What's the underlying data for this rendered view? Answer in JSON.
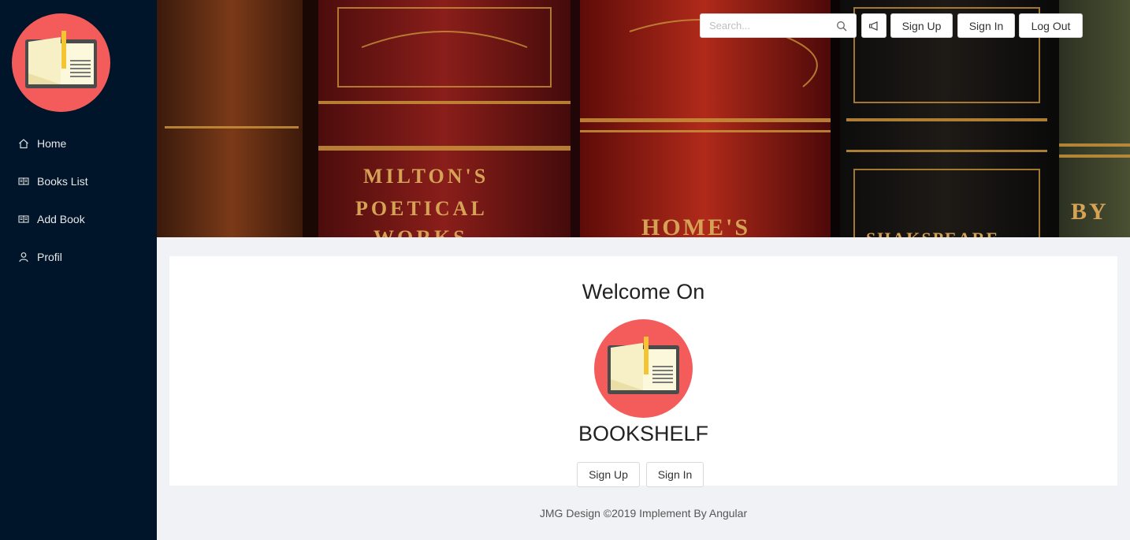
{
  "sidebar": {
    "logo_icon": "open-book-icon",
    "items": [
      {
        "label": "Home",
        "icon": "home-icon"
      },
      {
        "label": "Books List",
        "icon": "book-icon"
      },
      {
        "label": "Add Book",
        "icon": "book-icon"
      },
      {
        "label": "Profil",
        "icon": "user-icon"
      }
    ]
  },
  "header": {
    "search_placeholder": "Search...",
    "notify_icon": "megaphone-icon",
    "signup_label": "Sign Up",
    "signin_label": "Sign In",
    "logout_label": "Log Out"
  },
  "banner": {
    "spine_1": "MILTON'S",
    "spine_2": "POETICAL",
    "spine_3": "WORKS",
    "spine_4": "HOME'S",
    "spine_5": "SHAKSPEARE",
    "spine_6": "BY"
  },
  "main": {
    "welcome": "Welcome On",
    "brand": "BOOKSHELF",
    "signup_label": "Sign Up",
    "signin_label": "Sign In"
  },
  "footer": {
    "text": "JMG Design ©2019 Implement By Angular"
  },
  "colors": {
    "sidebar_bg": "#001529",
    "logo_circle": "#f45b5b",
    "page_bg": "#f0f2f5"
  }
}
